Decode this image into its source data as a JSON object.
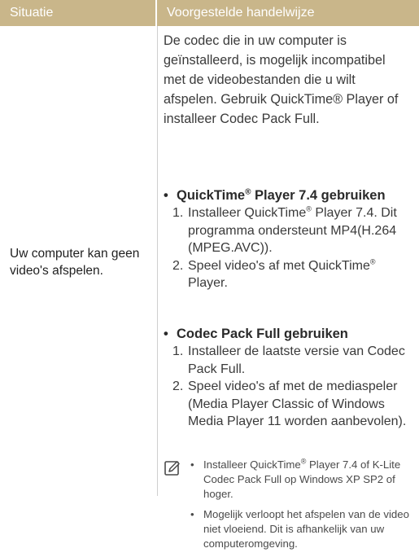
{
  "table": {
    "header": {
      "situatie": "Situatie",
      "handelwijze": "Voorgestelde handelwijze"
    },
    "situatie_text": "Uw computer kan geen video's afspelen.",
    "intro": "De codec die in uw computer is geïnstalleerd, is mogelijk incompatibel met de videobestanden die u wilt afspelen. Gebruik QuickTime® Player of installeer Codec Pack Full.",
    "section1": {
      "bullet": "•",
      "title_a": "QuickTime",
      "title_sup": "®",
      "title_b": " Player 7.4 gebruiken",
      "step1_num": "1.",
      "step1_a": "Installeer QuickTime",
      "step1_sup": "®",
      "step1_b": " Player 7.4. Dit programma ondersteunt MP4(H.264 (MPEG.AVC)).",
      "step2_num": "2.",
      "step2_a": "Speel video's af met QuickTime",
      "step2_sup": "®",
      "step2_b": " Player."
    },
    "section2": {
      "bullet": "•",
      "title": "Codec Pack Full gebruiken",
      "step1_num": "1.",
      "step1": "Installeer de laatste versie van Codec Pack Full.",
      "step2_num": "2.",
      "step2": "Speel video's af met de mediaspeler (Media Player Classic of Windows Media Player 11 worden aanbevolen)."
    },
    "note": {
      "icon": "note-pencil-icon",
      "bullet": "•",
      "item1_a": "Installeer QuickTime",
      "item1_sup": "®",
      "item1_b": " Player 7.4 of K-Lite Codec Pack Full op Windows XP SP2 of hoger.",
      "item2": "Mogelijk verloopt het afspelen van de video niet vloeiend. Dit is afhankelijk van uw computeromgeving."
    }
  },
  "colors": {
    "header_bg": "#c9b68a",
    "text": "#3a3a3a"
  }
}
